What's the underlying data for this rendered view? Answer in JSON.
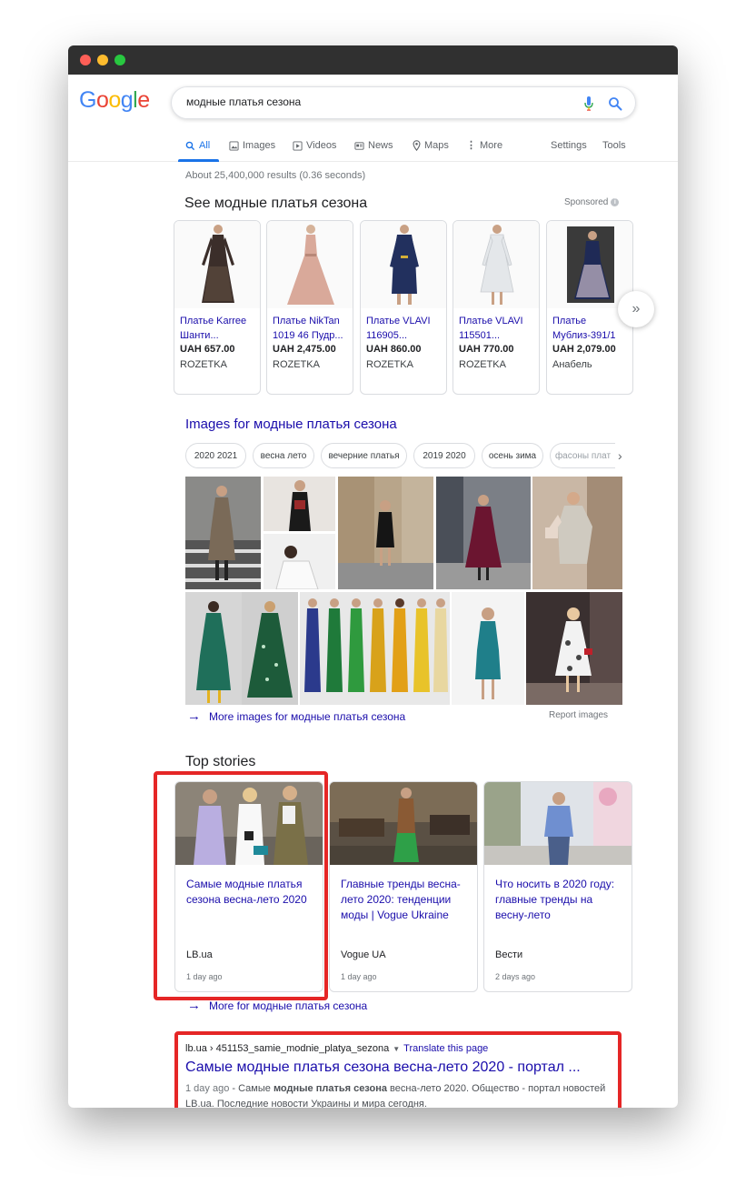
{
  "search": {
    "query": "модные платья сезона"
  },
  "tabs": [
    {
      "label": "All",
      "icon": "search-icon",
      "active": true
    },
    {
      "label": "Images",
      "icon": "image-icon"
    },
    {
      "label": "Videos",
      "icon": "play-icon"
    },
    {
      "label": "News",
      "icon": "news-icon"
    },
    {
      "label": "Maps",
      "icon": "map-pin-icon"
    },
    {
      "label": "More",
      "icon": "more-vert-icon"
    }
  ],
  "tools": {
    "settings": "Settings",
    "tools": "Tools"
  },
  "stats": "About 25,400,000 results (0.36 seconds)",
  "shopping": {
    "title": "See модные платья сезона",
    "sponsored": "Sponsored",
    "products": [
      {
        "name": "Платье Karree Шанти...",
        "price": "UAH 657.00",
        "store": "ROZETKA",
        "color": "#3b2e2a"
      },
      {
        "name": "Платье NikTan 1019 46 Пудр...",
        "price": "UAH 2,475.00",
        "store": "ROZETKA",
        "color": "#d9a99a"
      },
      {
        "name": "Платье VLAVI 116905...",
        "price": "UAH 860.00",
        "store": "ROZETKA",
        "color": "#22305e"
      },
      {
        "name": "Платье VLAVI 115501...",
        "price": "UAH 770.00",
        "store": "ROZETKA",
        "color": "#e9ecef"
      },
      {
        "name": "Платье Мублиз-391/1",
        "price": "UAH 2,079.00",
        "store": "Анабель",
        "color": "#1f2a56"
      }
    ]
  },
  "images": {
    "title": "Images for модные платья сезона",
    "chips": [
      "2020 2021",
      "весна лето",
      "вечерние платья",
      "2019 2020",
      "осень зима",
      "фасоны плат"
    ],
    "more": "More images for модные платья сезона",
    "report": "Report images"
  },
  "top_stories": {
    "title": "Top stories",
    "stories": [
      {
        "title": "Самые модные платья сезона весна-лето 2020",
        "source": "LB.ua",
        "time": "1 day ago"
      },
      {
        "title": "Главные тренды весна-лето 2020: тенденции моды | Vogue Ukraine",
        "source": "Vogue UA",
        "time": "1 day ago"
      },
      {
        "title": "Что носить в 2020 году: главные тренды на весну-лето",
        "source": "Вести",
        "time": "2 days ago"
      }
    ],
    "more": "More for модные платья сезона"
  },
  "result": {
    "cite": "lb.ua › 451153_samie_modnie_platya_sezona",
    "translate": "Translate this page",
    "title": "Самые модные платья сезона весна-лето 2020 - портал ...",
    "date": "1 day ago",
    "snippet_a": "Самые ",
    "snippet_bold": "модные платья сезона",
    "snippet_b": " весна-лето 2020. Общество - портал новостей LB.ua. Последние новости Украины и мира сегодня."
  },
  "colors": {
    "accent": "#1a73e8",
    "link": "#1a0dab",
    "highlight": "#e52626"
  }
}
